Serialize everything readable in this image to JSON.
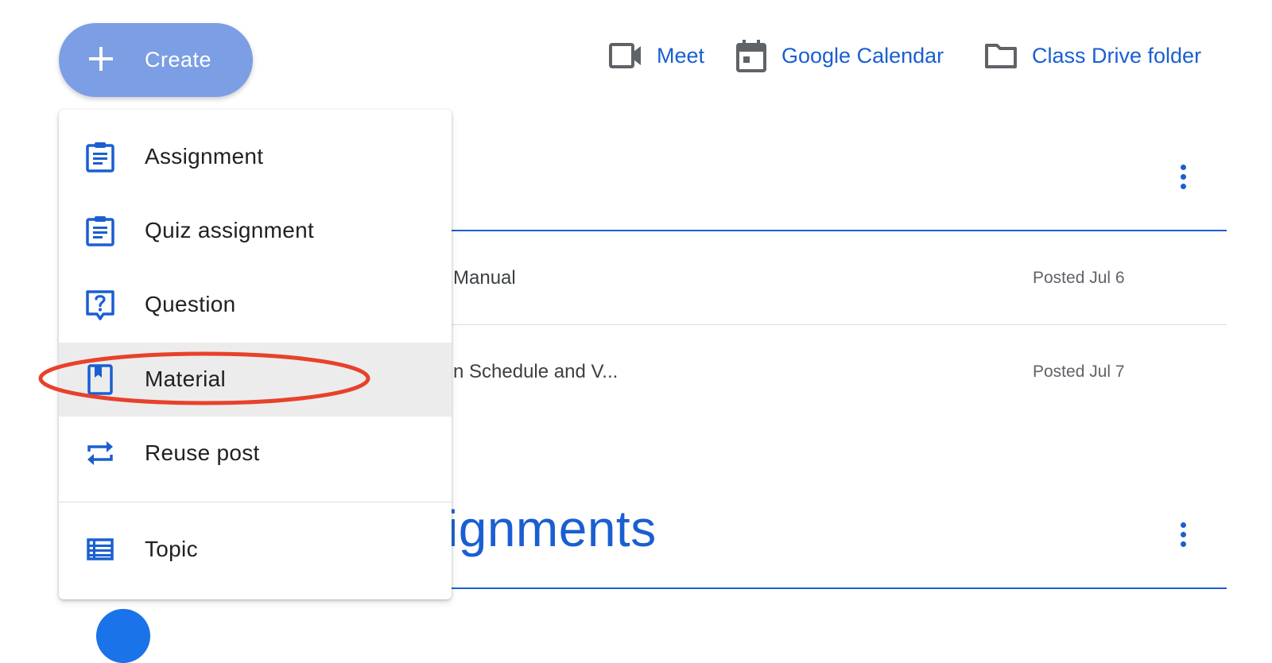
{
  "create_button": {
    "label": "Create",
    "icon": "plus-icon"
  },
  "top_links": [
    {
      "label": "Meet",
      "icon": "video-camera-icon"
    },
    {
      "label": "Google Calendar",
      "icon": "calendar-icon"
    },
    {
      "label": "Class Drive folder",
      "icon": "folder-icon"
    }
  ],
  "background": {
    "rows": [
      {
        "title": "Manual",
        "date": "Posted Jul 6"
      },
      {
        "title": "n Schedule and V...",
        "date": "Posted Jul 7"
      }
    ],
    "section_heading": "ignments"
  },
  "menu": {
    "items": [
      {
        "label": "Assignment",
        "icon": "assignment-icon"
      },
      {
        "label": "Quiz assignment",
        "icon": "quiz-assignment-icon"
      },
      {
        "label": "Question",
        "icon": "question-icon"
      },
      {
        "label": "Material",
        "icon": "material-icon",
        "highlighted": true
      },
      {
        "label": "Reuse post",
        "icon": "reuse-icon"
      },
      {
        "label": "Topic",
        "icon": "topic-icon"
      }
    ]
  },
  "colors": {
    "accent_blue": "#1a5fd1",
    "create_button": "#7b9ee4",
    "annotation_red": "#e8412b",
    "hover_gray": "#ececec"
  }
}
